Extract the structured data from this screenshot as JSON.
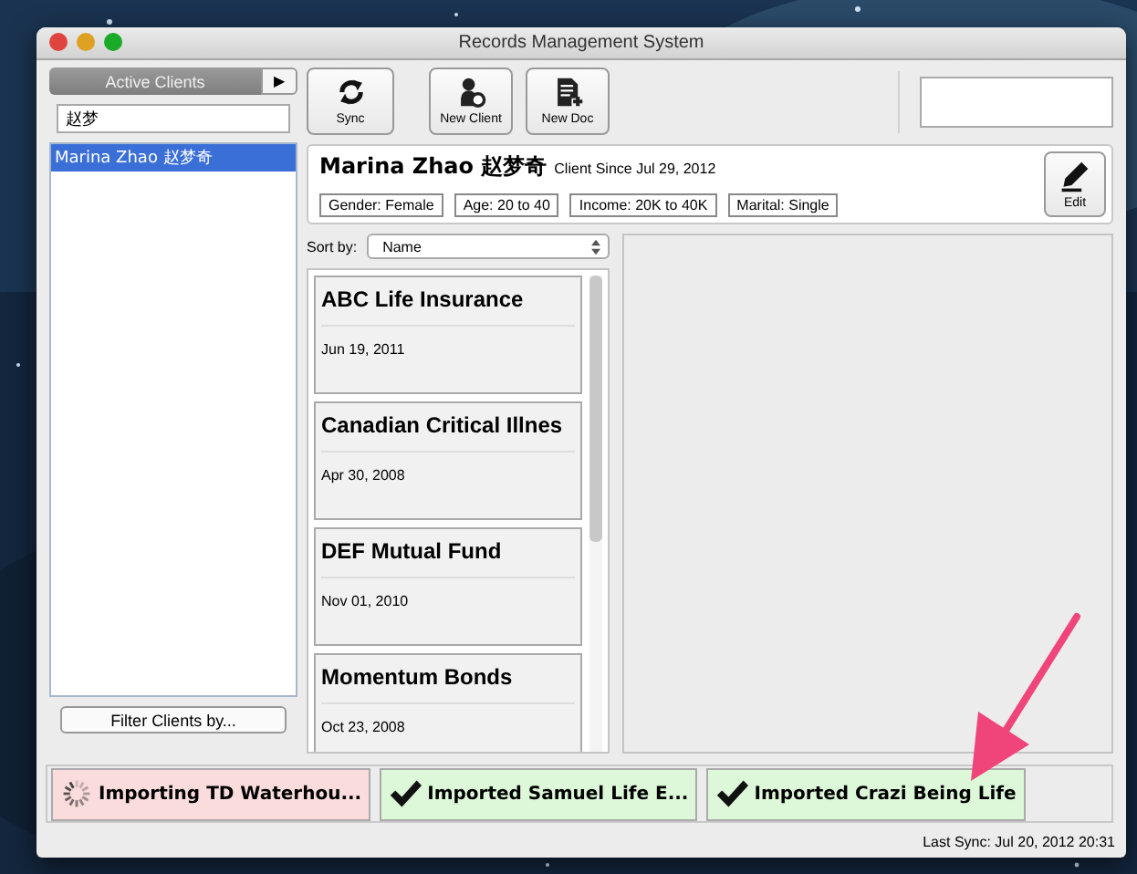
{
  "window": {
    "title": "Records Management System"
  },
  "sidebar": {
    "tab": "Active Clients",
    "tab_button": "▶",
    "search": {
      "value": "赵梦"
    },
    "clients": [
      {
        "name": "Marina Zhao 赵梦奇",
        "selected": true
      }
    ],
    "filter_button": "Filter Clients by..."
  },
  "toolbar": {
    "buttons": [
      {
        "label": "Sync",
        "kind": "sync"
      },
      {
        "label": "New Client",
        "kind": "client"
      },
      {
        "label": "New Doc",
        "kind": "doc"
      }
    ]
  },
  "client": {
    "name": "Marina Zhao 赵梦奇",
    "since": "Client Since Jul 29, 2012",
    "tags": [
      "Gender: Female",
      "Age: 20 to 40",
      "Income: 20K to 40K",
      "Marital: Single"
    ],
    "edit_button": "Edit"
  },
  "sort": {
    "label": "Sort by:",
    "value": "Name"
  },
  "documents": [
    {
      "title": "ABC Life Insurance",
      "date": "Jun 19, 2011"
    },
    {
      "title": "Canadian Critical Illnes",
      "date": "Apr 30, 2008"
    },
    {
      "title": "DEF Mutual Fund",
      "date": "Nov 01, 2010"
    },
    {
      "title": "Momentum Bonds",
      "date": "Oct 23, 2008"
    }
  ],
  "imports": [
    {
      "kind": "importing",
      "label": "Importing TD Waterhou..."
    },
    {
      "kind": "imported",
      "label": "Imported Samuel Life E..."
    },
    {
      "kind": "imported",
      "label": "Imported Crazi Being Life"
    }
  ],
  "status_bar": {
    "last_sync": "Last Sync: Jul 20, 2012 20:31"
  }
}
